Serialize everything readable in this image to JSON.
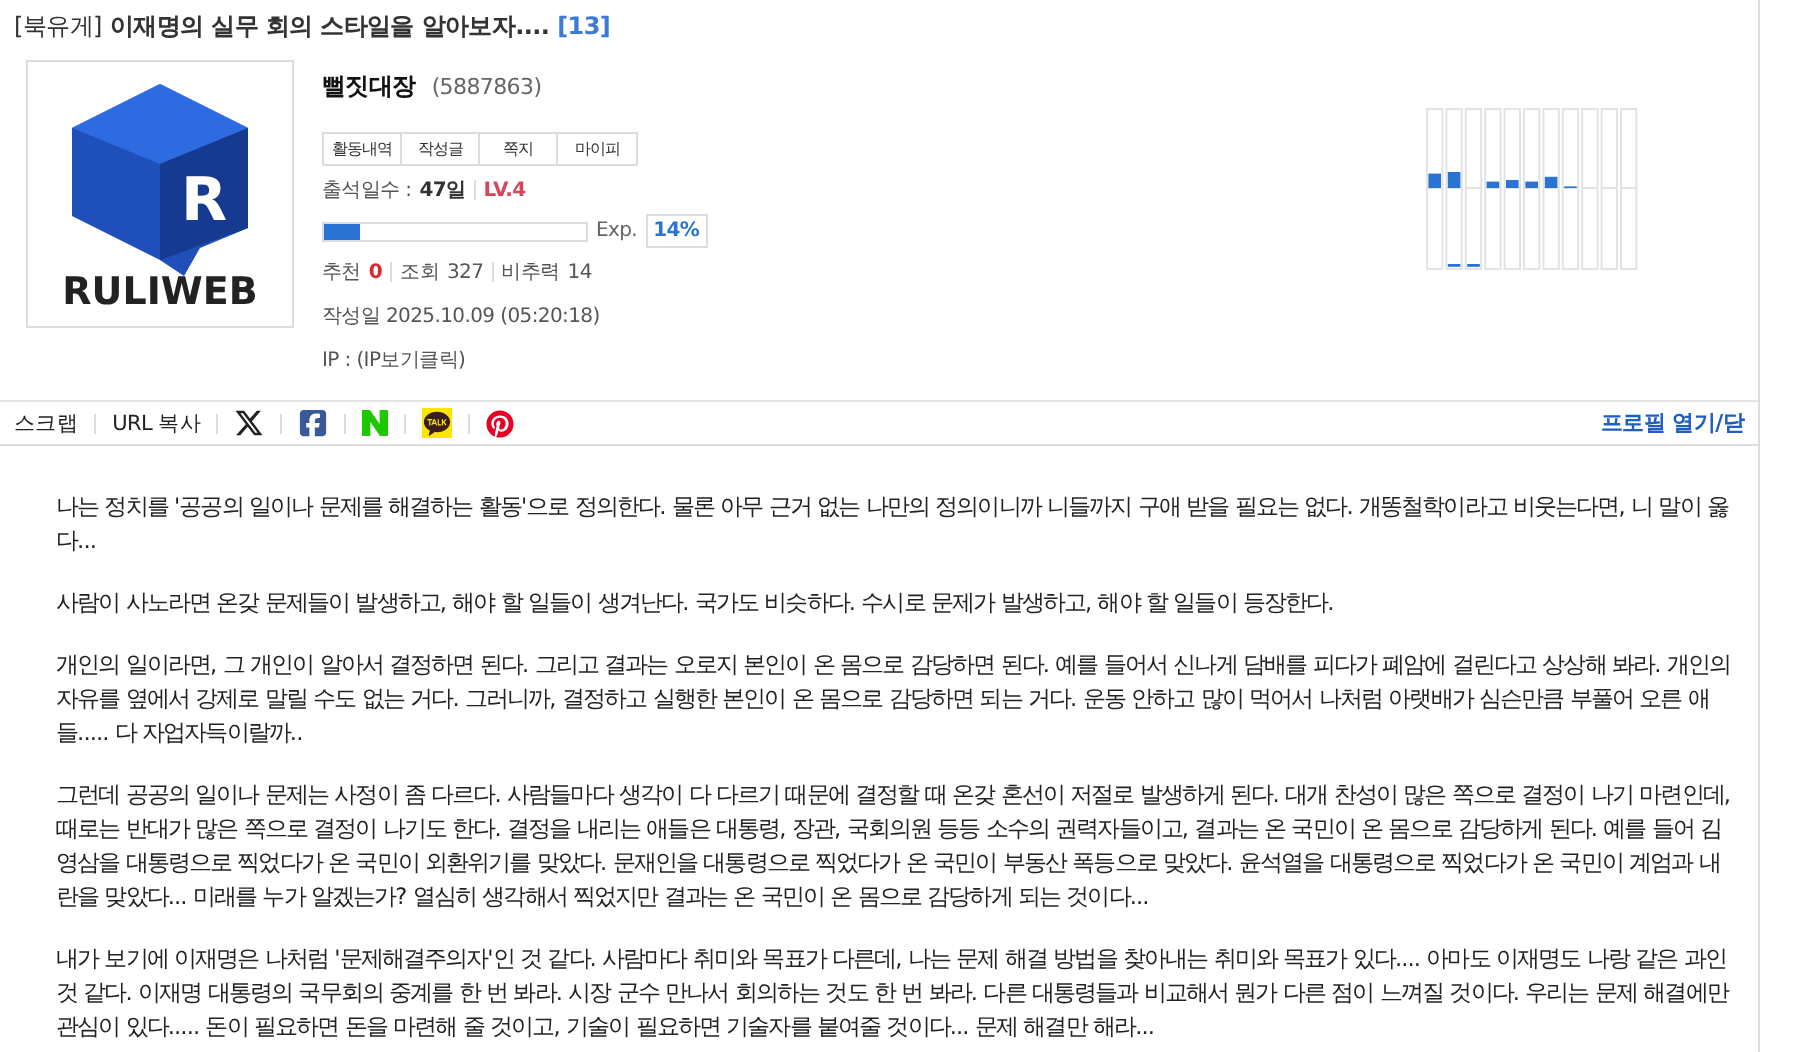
{
  "post": {
    "board": "[북유게]",
    "title": "이재명의 실무 회의 스타일을 알아보자....",
    "comment_count": "[13]"
  },
  "avatar": {
    "mark": "R",
    "wordmark": "RULIWEB"
  },
  "profile": {
    "name": "뻘짓대장",
    "user_id": "(5887863)",
    "tabs": [
      {
        "label": "활동내역"
      },
      {
        "label": "작성글"
      },
      {
        "label": "쪽지"
      },
      {
        "label": "마이피"
      }
    ],
    "attendance_label": "출석일수 :",
    "attendance_value": "47일",
    "level_badge": "LV.4",
    "exp": {
      "level": 0.14,
      "label": "Exp.",
      "percent": "14%"
    },
    "stats": [
      {
        "label": "추천",
        "value": "0",
        "kind": "hot"
      },
      {
        "label": "조회",
        "value": "327",
        "kind": "plain"
      },
      {
        "label": "비추력",
        "value": "14",
        "kind": "plain"
      }
    ],
    "date": "작성일 2025.10.09 (05:20:18)",
    "ip": "IP : (IP보기클릭)"
  },
  "share_bar": {
    "items": [
      {
        "kind": "text",
        "label": "스크랩"
      },
      {
        "kind": "text",
        "label": "URL 복사"
      },
      {
        "kind": "x"
      },
      {
        "kind": "facebook"
      },
      {
        "kind": "naver"
      },
      {
        "kind": "kakao"
      },
      {
        "kind": "pinterest"
      }
    ],
    "profile_toggle": "프로필 열기/닫"
  },
  "paragraphs": [
    "나는 정치를 '공공의 일이나 문제를 해결하는 활동'으로 정의한다. 물론 아무 근거 없는 나만의 정의이니까 니들까지 구애 받을 필요는 없다. 개똥철학이라고 비웃는다면, 니 말이 옳다...",
    "사람이 사노라면 온갖 문제들이 발생하고, 해야 할 일들이 생겨난다. 국가도 비슷하다. 수시로 문제가 발생하고, 해야 할 일들이 등장한다.",
    "개인의 일이라면, 그 개인이 알아서 결정하면 된다. 그리고 결과는 오로지 본인이 온 몸으로 감당하면 된다. 예를 들어서 신나게 담배를 피다가 폐암에 걸린다고 상상해 봐라. 개인의 자유를 옆에서 강제로 말릴 수도 없는 거다. 그러니까, 결정하고 실행한 본인이 온 몸으로 감당하면 되는 거다. 운동 안하고 많이 먹어서 나처럼 아랫배가 심슨만큼 부풀어 오른 애들..... 다 자업자득이랄까..",
    "그런데 공공의 일이나 문제는 사정이 좀 다르다. 사람들마다 생각이 다 다르기 때문에 결정할 때 온갖 혼선이 저절로 발생하게 된다. 대개 찬성이 많은 쪽으로 결정이 나기 마련인데, 때로는 반대가 많은 쪽으로 결정이 나기도 한다. 결정을 내리는 애들은 대통령, 장관, 국회의원 등등 소수의 권력자들이고, 결과는 온 국민이 온 몸으로 감당하게 된다. 예를 들어 김영삼을 대통령으로 찍었다가 온 국민이 외환위기를 맞았다. 문재인을 대통령으로 찍었다가 온 국민이 부동산 폭등으로 맞았다. 윤석열을 대통령으로 찍었다가 온 국민이 계엄과 내란을 맞았다... 미래를 누가 알겠는가? 열심히 생각해서 찍었지만 결과는 온 국민이 온 몸으로 감당하게 되는 것이다...",
    "내가 보기에 이재명은 나처럼 '문제해결주의자'인 것 같다. 사람마다 취미와 목표가 다른데, 나는 문제 해결 방법을 찾아내는 취미와 목표가 있다.... 아마도 이재명도 나랑 같은 과인 것 같다. 이재명 대통령의 국무회의 중계를 한 번 봐라. 시장 군수 만나서 회의하는 것도 한 번 봐라. 다른 대통령들과 비교해서 뭔가 다른 점이 느껴질 것이다. 우리는 문제 해결에만 관심이 있다..... 돈이 필요하면 돈을 마련해 줄 것이고, 기술이 필요하면 기술자를 붙여줄 것이다... 문제 해결만 해라..."
  ]
}
